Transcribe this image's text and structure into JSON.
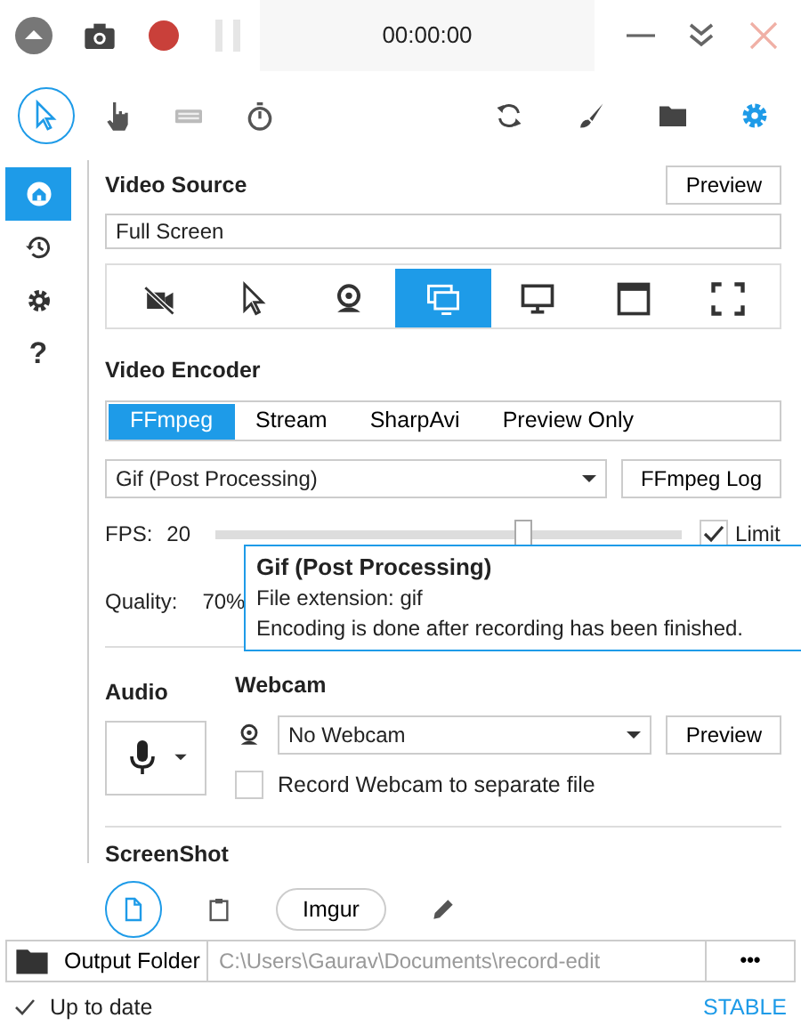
{
  "title_bar": {
    "timer": "00:00:00",
    "pause_disabled": true
  },
  "tools": [
    {
      "kind": "cursor",
      "selected": true
    },
    {
      "kind": "hand",
      "selected": false
    },
    {
      "kind": "keyboard",
      "selected": false
    },
    {
      "kind": "timer",
      "selected": false
    }
  ],
  "sidebar": [
    {
      "kind": "home",
      "selected": true
    },
    {
      "kind": "history",
      "selected": false
    },
    {
      "kind": "settings",
      "selected": false
    },
    {
      "kind": "help",
      "label": "?",
      "selected": false
    }
  ],
  "video_source": {
    "heading": "Video Source",
    "preview_button": "Preview",
    "value": "Full Screen",
    "sources": [
      {
        "kind": "none",
        "selected": false
      },
      {
        "kind": "region",
        "selected": false
      },
      {
        "kind": "webcam",
        "selected": false
      },
      {
        "kind": "screens",
        "selected": true
      },
      {
        "kind": "screen",
        "selected": false
      },
      {
        "kind": "window",
        "selected": false
      },
      {
        "kind": "fullscreen",
        "selected": false
      }
    ]
  },
  "video_encoder": {
    "heading": "Video Encoder",
    "tabs": [
      {
        "label": "FFmpeg",
        "selected": true
      },
      {
        "label": "Stream",
        "selected": false
      },
      {
        "label": "SharpAvi",
        "selected": false
      },
      {
        "label": "Preview Only",
        "selected": false
      }
    ],
    "codec": "Gif (Post Processing)",
    "log_button": "FFmpeg Log",
    "fps_label": "FPS:",
    "fps_value": "20",
    "fps_slider": {
      "level": 0.66
    },
    "limit": {
      "label": "Limit",
      "checked": true
    },
    "quality_label": "Quality:",
    "quality_value": "70%",
    "tooltip": {
      "title": "Gif (Post Processing)",
      "lines": [
        "File extension: gif",
        "Encoding is done after recording has been finished."
      ]
    }
  },
  "audio": {
    "heading": "Audio"
  },
  "webcam": {
    "heading": "Webcam",
    "value": "No Webcam",
    "preview_button": "Preview",
    "separate_file": {
      "label": "Record Webcam to separate file",
      "checked": false
    }
  },
  "screenshot": {
    "heading": "ScreenShot",
    "targets": [
      {
        "kind": "disk",
        "selected": true
      },
      {
        "kind": "clipboard",
        "selected": false
      },
      {
        "kind": "imgur",
        "label": "Imgur",
        "selected": false
      },
      {
        "kind": "editor",
        "selected": false
      }
    ]
  },
  "output_folder": {
    "label": "Output Folder",
    "path": "C:\\Users\\Gaurav\\Documents\\record-edit",
    "more_button": "•••"
  },
  "status_bar": {
    "status": "Up to date",
    "channel": "STABLE"
  }
}
